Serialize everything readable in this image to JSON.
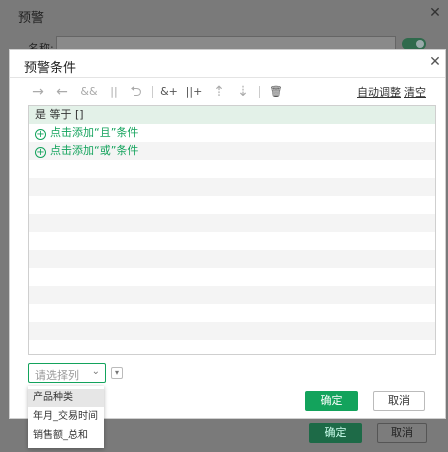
{
  "outer": {
    "title": "预警",
    "close_glyph": "✕",
    "name_label": "名称:",
    "ok_label": "确定",
    "cancel_label": "取消"
  },
  "dialog": {
    "title": "预警条件",
    "close_glyph": "✕",
    "toolbar": {
      "auto_adjust_label": "自动调整",
      "clear_label": "清空",
      "icons": [
        {
          "name": "arrow-right-icon",
          "glyph": "→"
        },
        {
          "name": "arrow-left-icon",
          "glyph": "←"
        },
        {
          "name": "and-icon",
          "glyph": "&&"
        },
        {
          "name": "or-icon",
          "glyph": "||"
        },
        {
          "name": "return-icon",
          "glyph": "⮌"
        },
        {
          "name": "add-and-icon",
          "glyph": "&+"
        },
        {
          "name": "add-or-icon",
          "glyph": "||+"
        },
        {
          "name": "move-up-icon",
          "glyph": "⇡"
        },
        {
          "name": "move-down-icon",
          "glyph": "⇣"
        },
        {
          "name": "delete-icon",
          "glyph": "🗑"
        }
      ]
    },
    "conditions": {
      "first_row": "是 等于 []",
      "add_and": "点击添加“且”条件",
      "add_or": "点击添加“或”条件",
      "add_glyph": "+"
    },
    "select": {
      "placeholder": "请选择列",
      "chevron": "⌄",
      "mini_chevron": "▾"
    },
    "ok_label": "确定",
    "cancel_label": "取消"
  },
  "dropdown": {
    "options": [
      "产品种类",
      "年月_交易时间",
      "销售额_总和"
    ],
    "highlighted_index": 0
  },
  "colors": {
    "accent": "#13a35c",
    "selected_row": "#e3f1e8",
    "overlay": "#7a7a7a"
  }
}
